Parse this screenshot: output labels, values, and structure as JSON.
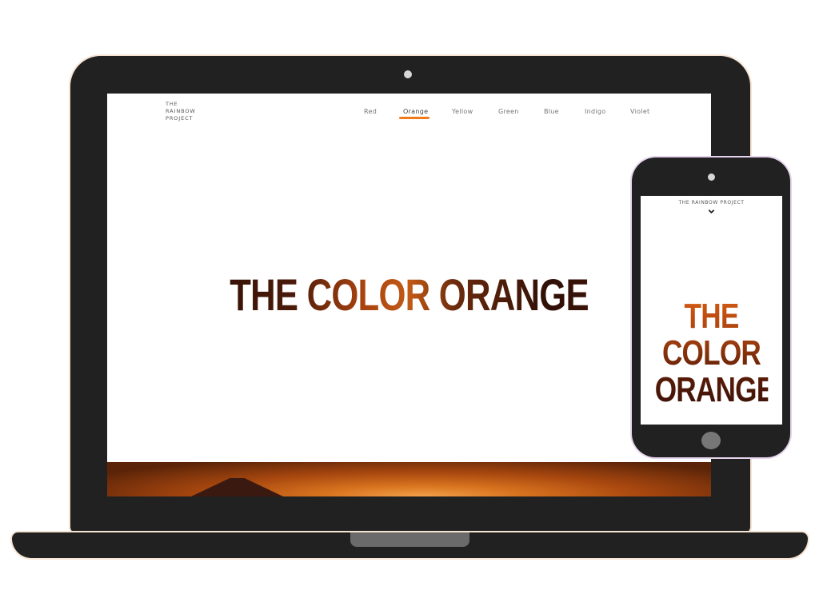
{
  "site": {
    "logo": "THE RAINBOW PROJECT",
    "nav": [
      {
        "label": "Red",
        "active": false
      },
      {
        "label": "Orange",
        "active": true
      },
      {
        "label": "Yellow",
        "active": false
      },
      {
        "label": "Green",
        "active": false
      },
      {
        "label": "Blue",
        "active": false
      },
      {
        "label": "Indigo",
        "active": false
      },
      {
        "label": "Violet",
        "active": false
      }
    ],
    "hero_title": "THE COLOR ORANGE",
    "accent_color": "#f07b1a"
  },
  "phone": {
    "logo": "THE RAINBOW PROJECT",
    "hero_title_line1": "THE COLOR",
    "hero_title_line2": "ORANGE",
    "menu_icon": "chevron-down-icon"
  }
}
